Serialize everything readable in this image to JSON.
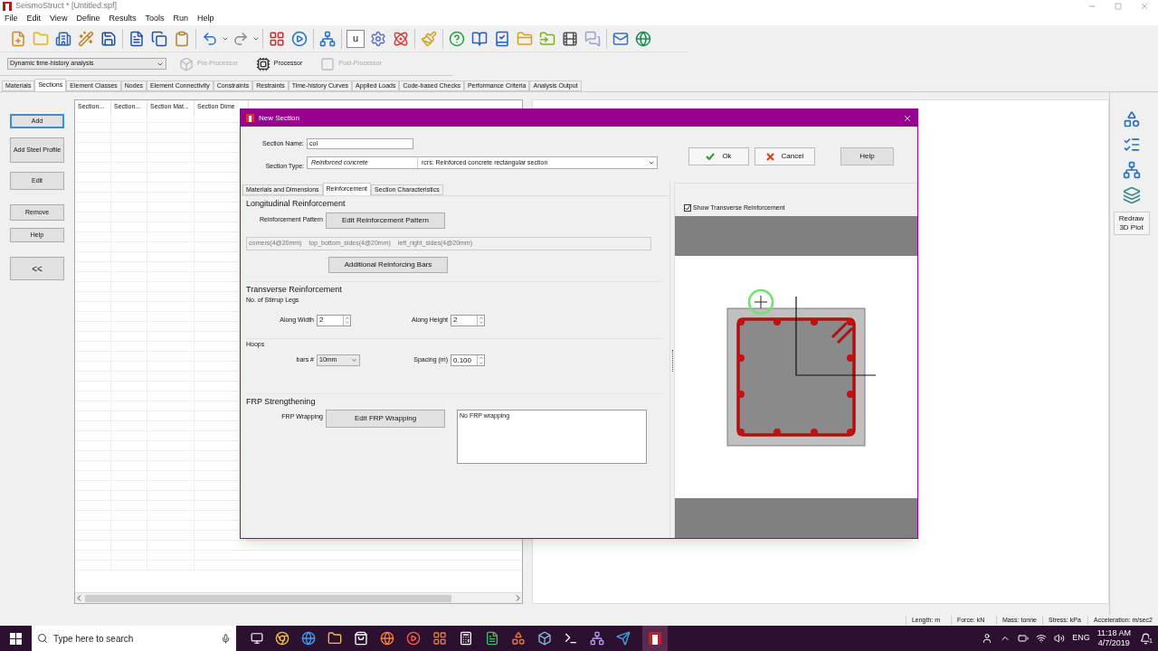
{
  "window": {
    "title": "SeismoStruct * [Untitled.spf]"
  },
  "menu": [
    "File",
    "Edit",
    "View",
    "Define",
    "Results",
    "Tools",
    "Run",
    "Help"
  ],
  "toolbar": {
    "text_button": "u"
  },
  "analysis_select": {
    "value": "Dynamic time-history analysis"
  },
  "modules": [
    {
      "label": "Pre-Processor",
      "disabled": true
    },
    {
      "label": "Processor",
      "disabled": false
    },
    {
      "label": "Post-Processor",
      "disabled": true
    }
  ],
  "tabs": [
    {
      "label": "Materials",
      "selected": false
    },
    {
      "label": "Sections",
      "selected": true
    },
    {
      "label": "Element Classes",
      "selected": false
    },
    {
      "label": "Nodes",
      "selected": false
    },
    {
      "label": "Element Connectivity",
      "selected": false
    },
    {
      "label": "Constraints",
      "selected": false
    },
    {
      "label": "Restraints",
      "selected": false
    },
    {
      "label": "Time-history Curves",
      "selected": false
    },
    {
      "label": "Applied Loads",
      "selected": false
    },
    {
      "label": "Code-based Checks",
      "selected": false
    },
    {
      "label": "Performance Criteria",
      "selected": false
    },
    {
      "label": "Analysis Output",
      "selected": false
    }
  ],
  "side_buttons": [
    {
      "label": "Add",
      "selected": true
    },
    {
      "label": "Add Steel Profile",
      "selected": false
    },
    {
      "label": "Edit",
      "selected": false
    },
    {
      "label": "Remove",
      "selected": false
    },
    {
      "label": "Help",
      "selected": false
    },
    {
      "label": "<<",
      "selected": false
    }
  ],
  "table": {
    "columns": [
      "Section...",
      "Section...",
      "Section Mat...",
      "Section Dime"
    ]
  },
  "dialog": {
    "title": "New Section",
    "section_name": {
      "label": "Section Name:",
      "value": "col"
    },
    "section_type": {
      "label": "Section Type:",
      "material": "Reinforced concrete",
      "value": "rcrs: Reinforced concrete rectangular section"
    },
    "buttons": [
      "Ok",
      "Cancel",
      "Help"
    ],
    "tabs": [
      {
        "label": "Materials and Dimensions",
        "selected": false
      },
      {
        "label": "Reinforcement",
        "selected": true
      },
      {
        "label": "Section Characteristics",
        "selected": false
      }
    ],
    "longitudinal": {
      "heading": "Longitudinal Reinforcement",
      "pattern_label": "Reinforcement Pattern",
      "edit_button": "Edit Reinforcement Pattern",
      "pattern": [
        "corners(4@20mm)",
        "top_bottom_sides(4@20mm)",
        "left_right_sides(4@20mm)"
      ],
      "additional_button": "Additional Reinforcing Bars"
    },
    "transverse": {
      "heading": "Transverse Reinforcement",
      "stirrup_legs": "No. of Stirrup Legs",
      "along_width": {
        "label": "Along Width",
        "value": "2"
      },
      "along_height": {
        "label": "Along Height",
        "value": "2"
      },
      "hoops": "Hoops",
      "bars": {
        "label": "bars #",
        "value": "10mm"
      },
      "spacing": {
        "label": "Spacing (m)",
        "value": "0.100"
      }
    },
    "frp": {
      "heading": "FRP Strengthening",
      "label": "FRP Wrapping",
      "button": "Edit FRP Wrapping",
      "text": "No FRP wrapping"
    },
    "show_transverse": {
      "label": "Show Transverse Reinforcement",
      "checked": true
    }
  },
  "redraw_button": "Redraw\n3D Plot",
  "status_bar": [
    "Length: m",
    "Force: kN",
    "Mass: tonne",
    "Stress: kPa",
    "Acceleration: m/sec2"
  ],
  "taskbar": {
    "search_placeholder": "Type here to search",
    "language": "ENG",
    "time": "11:18 AM",
    "date": "4/7/2019",
    "notifications": "1"
  }
}
